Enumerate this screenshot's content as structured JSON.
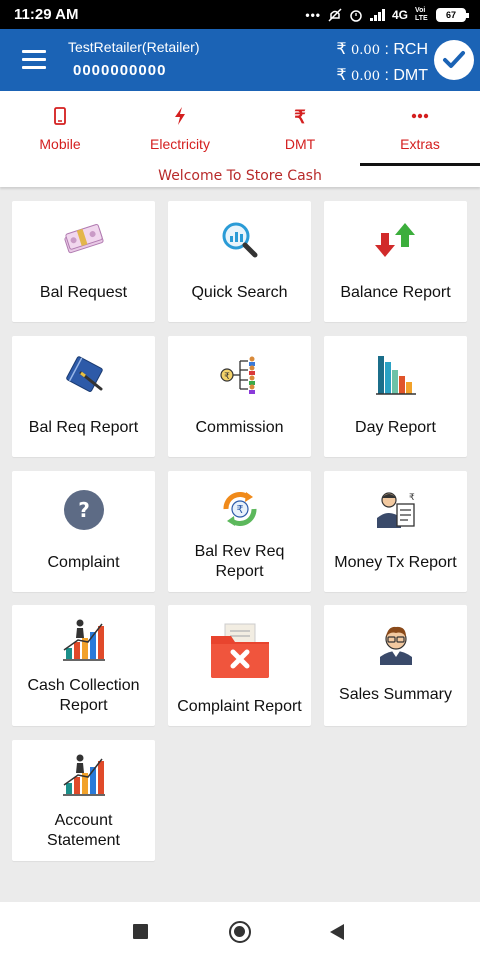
{
  "status_bar": {
    "time": "11:29 AM",
    "network": "4G",
    "volte": "Voi LTE",
    "battery": "67"
  },
  "header": {
    "user_name": "TestRetailer(Retailer)",
    "user_mobile": "0000000000",
    "balances": [
      {
        "symbol": "₹",
        "amount": "0.00",
        "label": ": RCH"
      },
      {
        "symbol": "₹",
        "amount": "0.00",
        "label": ": DMT"
      }
    ],
    "accent_color": "#1b63b5"
  },
  "tabs": [
    {
      "label": "Mobile",
      "icon": "mobile-icon"
    },
    {
      "label": "Electricity",
      "icon": "lightning-icon"
    },
    {
      "label": "DMT",
      "icon": "rupee-icon"
    },
    {
      "label": "Extras",
      "icon": "dots-icon",
      "active": true
    }
  ],
  "welcome_text": "Welcome To Store Cash",
  "tiles": [
    {
      "label": "Bal Request",
      "icon": "money-bundle-icon"
    },
    {
      "label": "Quick Search",
      "icon": "magnifier-chart-icon"
    },
    {
      "label": "Balance Report",
      "icon": "up-down-arrows-icon"
    },
    {
      "label": "Bal Req Report",
      "icon": "notebook-pen-icon"
    },
    {
      "label": "Commission",
      "icon": "commission-tree-icon"
    },
    {
      "label": "Day Report",
      "icon": "bar-chart-icon"
    },
    {
      "label": "Complaint",
      "icon": "question-icon"
    },
    {
      "label": "Bal Rev Req Report",
      "icon": "rupee-refresh-icon"
    },
    {
      "label": "Money Tx Report",
      "icon": "person-report-icon"
    },
    {
      "label": "Cash Collection Report",
      "icon": "growth-chart-icon"
    },
    {
      "label": "Complaint Report",
      "icon": "folder-cross-icon"
    },
    {
      "label": "Sales Summary",
      "icon": "person-avatar-icon"
    },
    {
      "label": "Account Statement",
      "icon": "growth-chart-icon"
    }
  ]
}
